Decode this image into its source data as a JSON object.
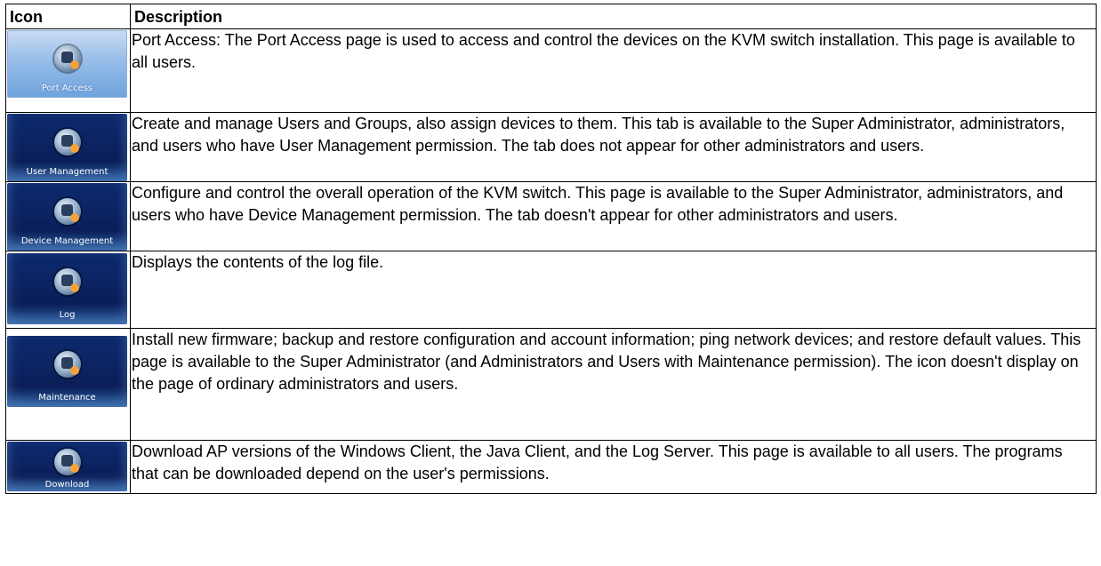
{
  "table": {
    "headers": {
      "icon": "Icon",
      "description": "Description"
    },
    "rows": [
      {
        "icon_name": "port-access-icon",
        "icon_label": "Port Access",
        "description": "Port Access: The Port Access page is used to access and control the devices on the KVM switch installation. This page is available to all users."
      },
      {
        "icon_name": "user-management-icon",
        "icon_label": "User Management",
        "description": " Create and manage Users and Groups, also assign devices to them. This tab is available to the Super Administrator, administrators, and users who have User Management permission. The tab does not appear for other administrators and users."
      },
      {
        "icon_name": "device-management-icon",
        "icon_label": "Device Management",
        "description": "Configure and control the overall operation of the KVM switch. This page is available to the Super Administrator, administrators, and users who have Device Management permission. The tab doesn't appear for other administrators and users."
      },
      {
        "icon_name": "log-icon",
        "icon_label": "Log",
        "description": "Displays the contents of the log file."
      },
      {
        "icon_name": "maintenance-icon",
        "icon_label": "Maintenance",
        "description": "Install new firmware; backup and restore configuration and account information; ping network devices; and restore default values. This page is available to the Super Administrator (and Administrators and Users with Maintenance permission). The icon doesn't display on the page of ordinary administrators and users."
      },
      {
        "icon_name": "download-icon",
        "icon_label": "Download",
        "description": "Download AP versions of the Windows Client, the Java Client, and the Log Server. This page is available to all users. The programs that can be downloaded depend on the user's permissions."
      }
    ]
  }
}
